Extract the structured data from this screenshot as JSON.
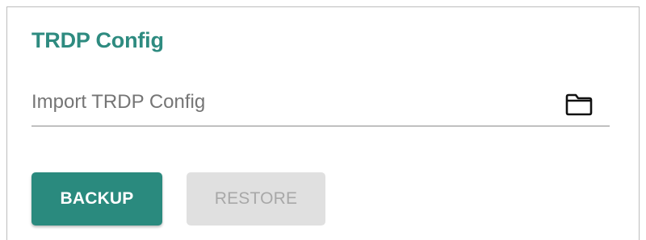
{
  "panel": {
    "title": "TRDP Config",
    "accent_color": "#2e8b80"
  },
  "import_field": {
    "placeholder": "Import TRDP Config",
    "value": "",
    "icon": "folder-icon"
  },
  "actions": {
    "backup_label": "BACKUP",
    "backup_color": "#2a8a7e",
    "restore_label": "RESTORE",
    "restore_enabled": false
  }
}
